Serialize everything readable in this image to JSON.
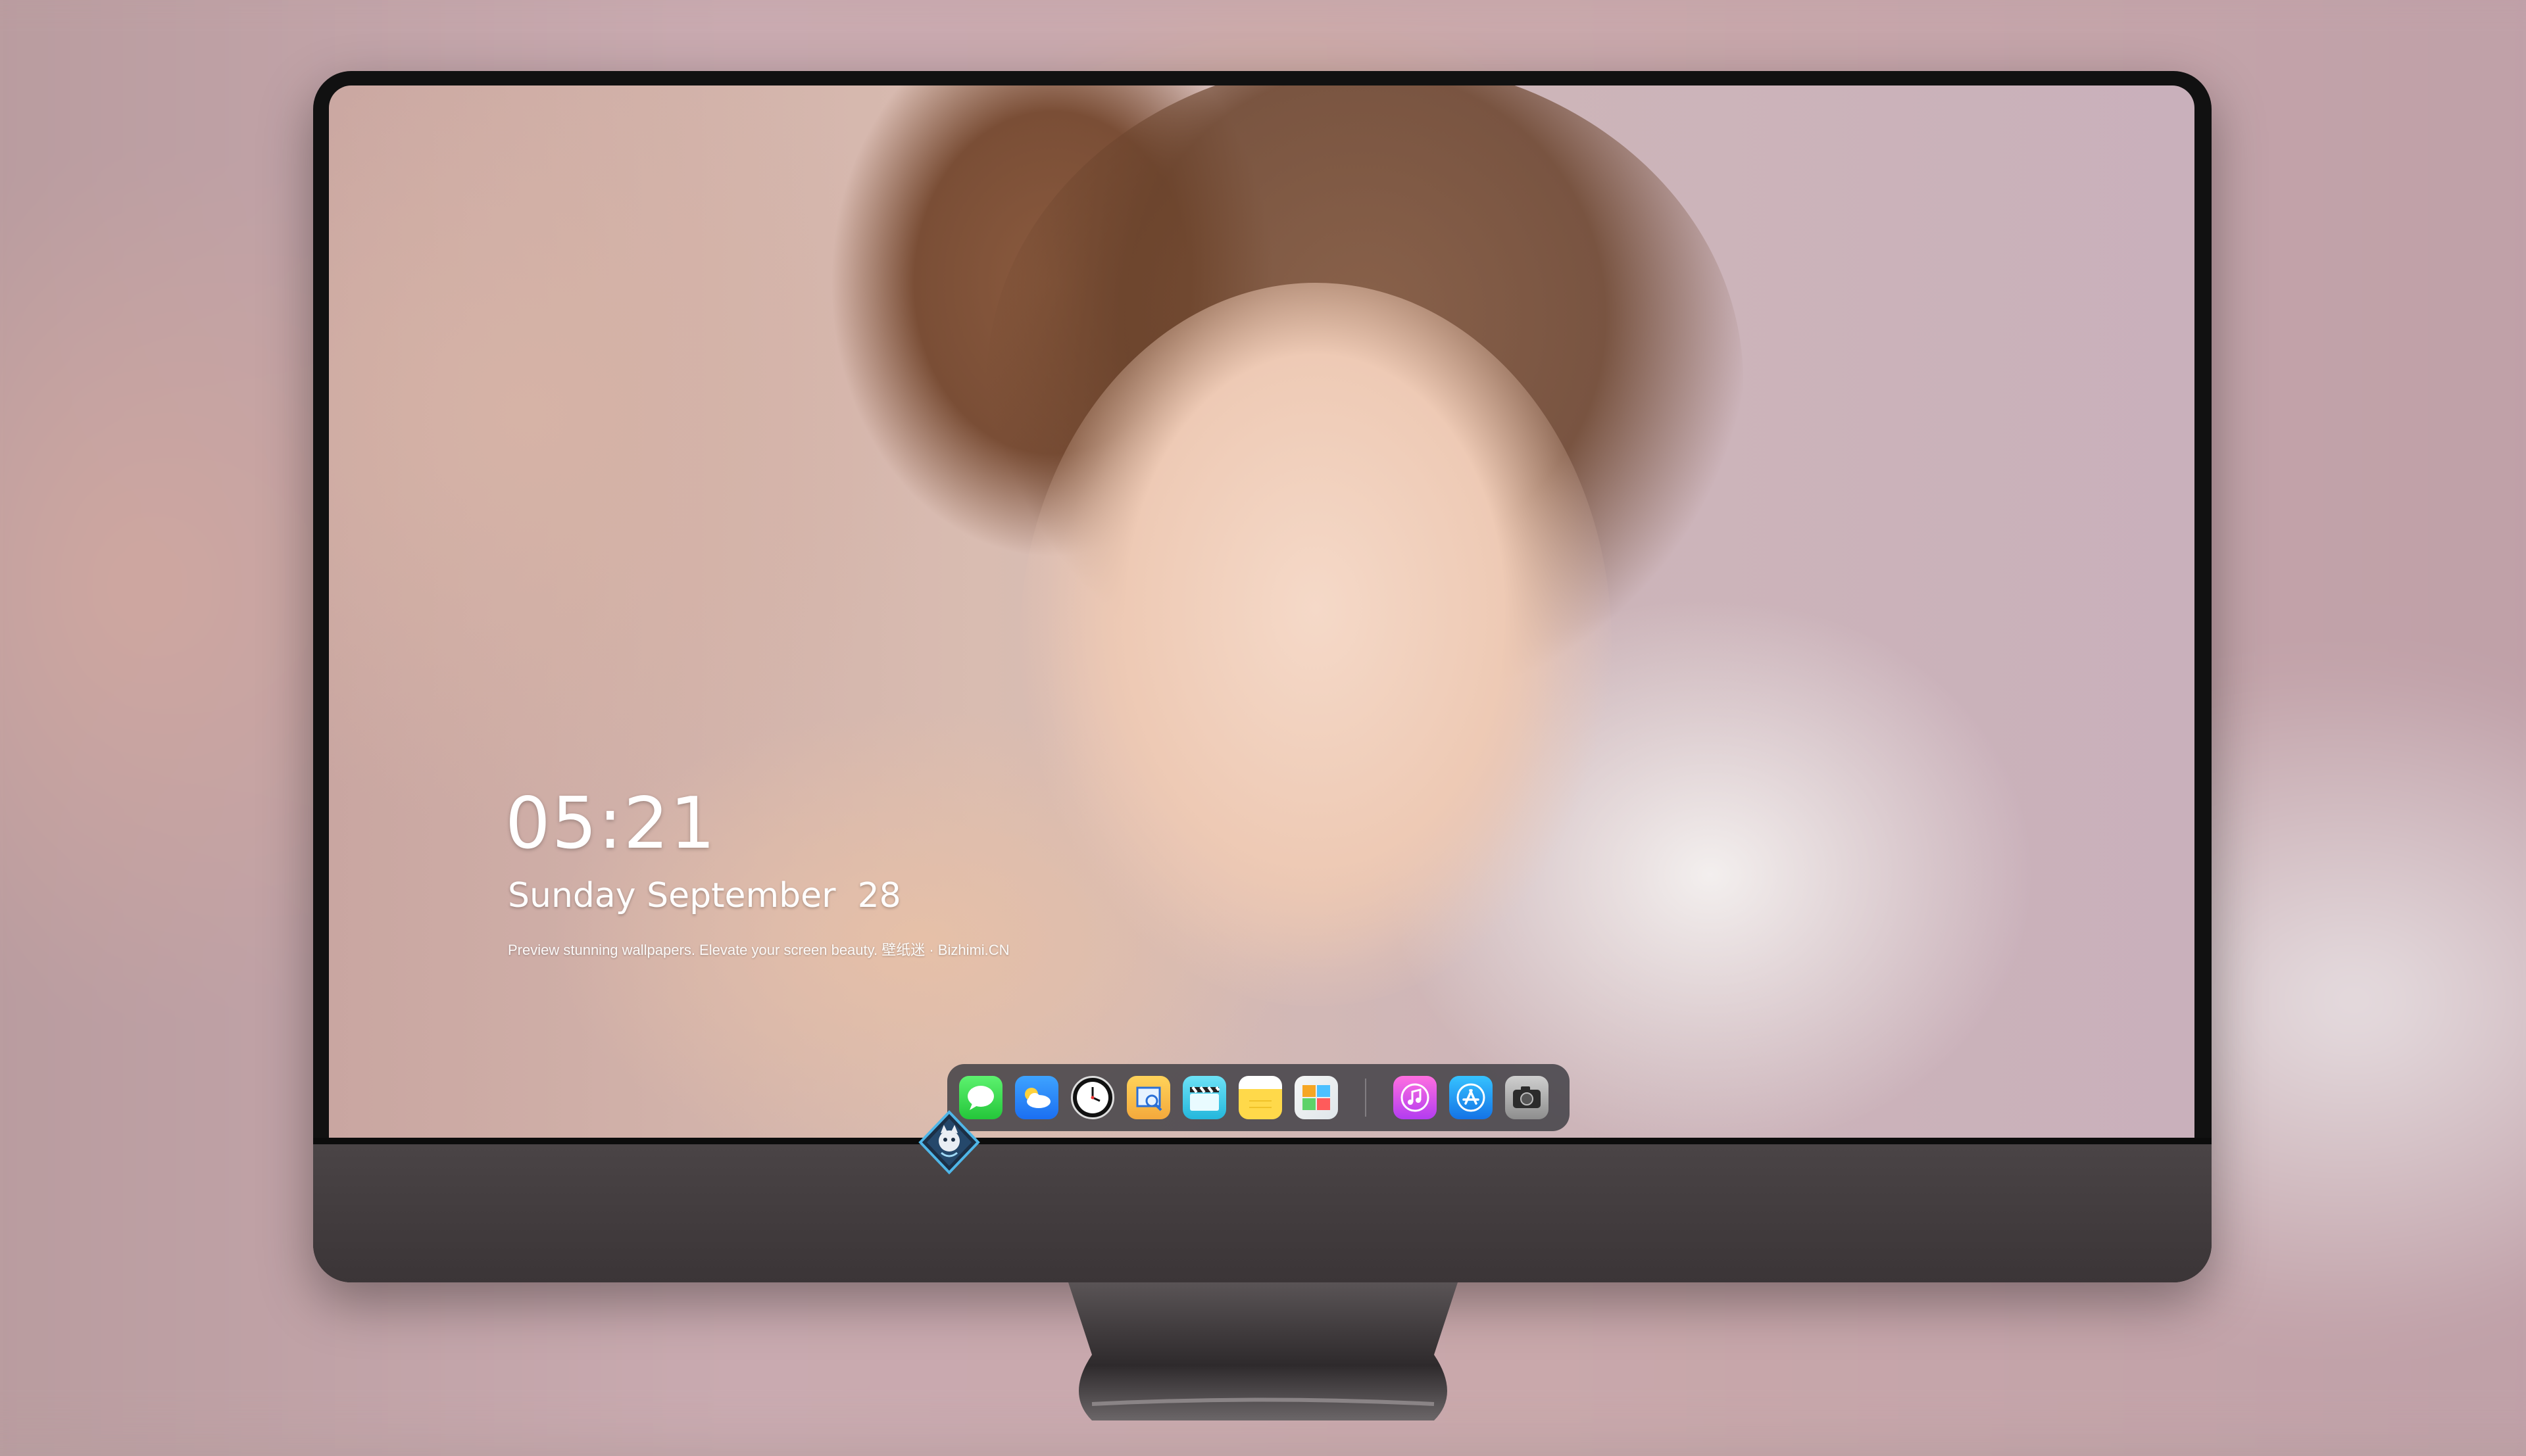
{
  "lockscreen": {
    "time": "05:21",
    "date": "Sunday September  28",
    "tagline": "Preview stunning wallpapers. Elevate your screen beauty. 壁纸迷 · Bizhimi.CN"
  },
  "dock": {
    "apps": [
      {
        "name": "Messages",
        "icon": "messages-icon"
      },
      {
        "name": "Weather",
        "icon": "weather-icon"
      },
      {
        "name": "Clock",
        "icon": "clock-icon"
      },
      {
        "name": "Preview",
        "icon": "preview-icon"
      },
      {
        "name": "Video",
        "icon": "clapperboard-icon"
      },
      {
        "name": "Notes",
        "icon": "notes-icon"
      },
      {
        "name": "Photos",
        "icon": "photos-icon"
      },
      {
        "name": "Music",
        "icon": "music-icon"
      },
      {
        "name": "App Store",
        "icon": "app-store-icon"
      },
      {
        "name": "Camera",
        "icon": "camera-icon"
      }
    ]
  },
  "brand_logo": "bizhimi-logo-icon",
  "colors": {
    "bezel": "#111111",
    "chin": "#3d3739",
    "dock_bg": "#3c3c42"
  }
}
